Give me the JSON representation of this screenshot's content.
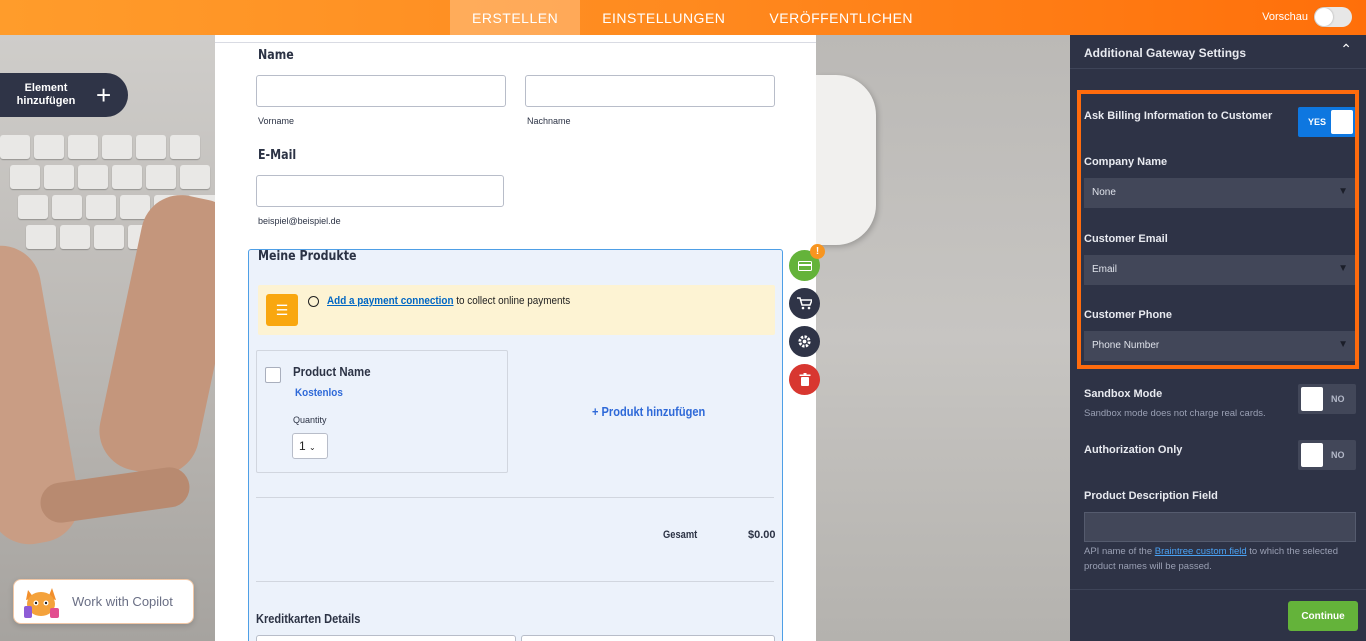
{
  "topbar": {
    "tabs": [
      {
        "label": "ERSTELLEN",
        "active": true
      },
      {
        "label": "EINSTELLUNGEN",
        "active": false
      },
      {
        "label": "VERÖFFENTLICHEN",
        "active": false
      }
    ],
    "preview_label": "Vorschau",
    "preview_on": false
  },
  "left": {
    "add_element_label": "Element hinzufügen",
    "copilot_label": "Work with Copilot"
  },
  "form": {
    "name_label": "Name",
    "first_sub": "Vorname",
    "last_sub": "Nachname",
    "email_label": "E-Mail",
    "email_sub": "beispiel@beispiel.de",
    "products": {
      "title": "Meine Produkte",
      "notice_link": "Add a payment connection",
      "notice_rest": " to collect online payments",
      "product_name": "Product Name",
      "product_price": "Kostenlos",
      "quantity_label": "Quantity",
      "quantity_value": "1",
      "add_product": "+ Produkt hinzufügen",
      "total_label": "Gesamt",
      "total_value": "$0.00",
      "cc_title": "Kreditkarten Details"
    }
  },
  "fab": {
    "payment_badge": "!"
  },
  "panel": {
    "title": "Additional Gateway Settings",
    "ask_billing_label": "Ask Billing Information to Customer",
    "ask_billing_value": "YES",
    "company_label": "Company Name",
    "company_value": "None",
    "email_label": "Customer Email",
    "email_value": "Email",
    "phone_label": "Customer Phone",
    "phone_value": "Phone Number",
    "sandbox_label": "Sandbox Mode",
    "sandbox_hint": "Sandbox mode does not charge real cards.",
    "sandbox_value": "NO",
    "auth_label": "Authorization Only",
    "auth_value": "NO",
    "desc_label": "Product Description Field",
    "desc_hint_pre": "API name of the ",
    "desc_hint_link": "Braintree custom field",
    "desc_hint_post": " to which the selected product names will be passed.",
    "continue_label": "Continue"
  },
  "colors": {
    "topbar": "#ff8a1f",
    "panel": "#2e3346",
    "accent_blue": "#0e77e0",
    "green": "#64b33a",
    "highlight": "#ff6b0d"
  }
}
